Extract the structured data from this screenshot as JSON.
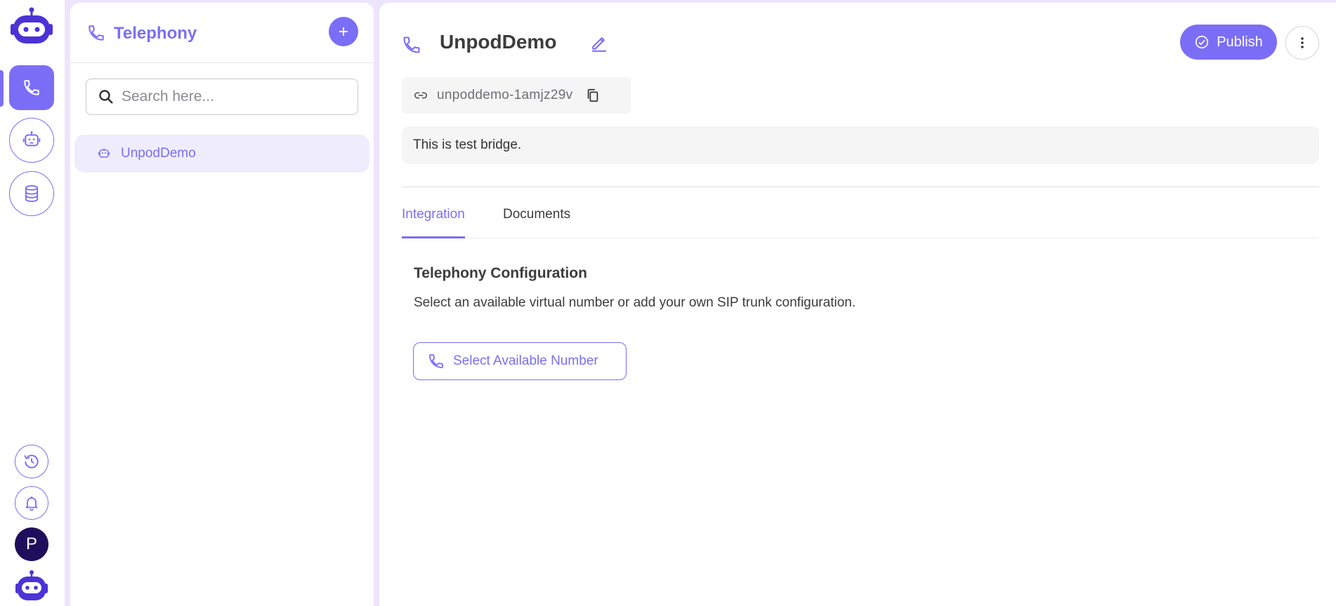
{
  "rail": {
    "avatar_initial": "P",
    "accent_color": "#7b6ef6",
    "items": [
      {
        "icon": "phone-icon",
        "active": true
      },
      {
        "icon": "robot-icon",
        "active": false
      },
      {
        "icon": "database-icon",
        "active": false
      }
    ],
    "bottom_items": [
      {
        "icon": "history-icon"
      },
      {
        "icon": "bell-icon"
      }
    ]
  },
  "sidebar": {
    "title": "Telephony",
    "search_placeholder": "Search here...",
    "items": [
      {
        "label": "UnpodDemo",
        "icon": "robot-icon",
        "selected": true
      }
    ]
  },
  "main": {
    "title": "UnpodDemo",
    "publish_label": "Publish",
    "slug": "unpoddemo-1amjz29v",
    "description": "This is test bridge.",
    "tabs": [
      {
        "label": "Integration",
        "active": true
      },
      {
        "label": "Documents",
        "active": false
      }
    ],
    "config": {
      "title": "Telephony Configuration",
      "description": "Select an available virtual number or add your own SIP trunk configuration.",
      "select_button_label": "Select Available Number"
    }
  }
}
